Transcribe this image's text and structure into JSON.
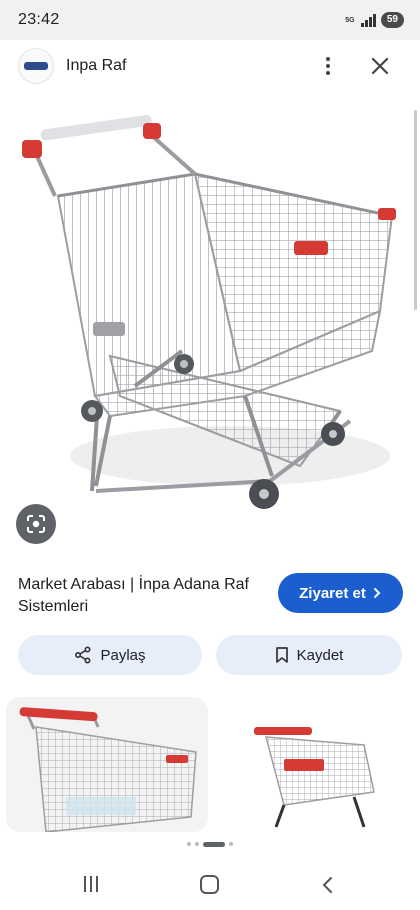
{
  "status_bar": {
    "time": "23:42",
    "network": "5G",
    "battery": "59"
  },
  "header": {
    "site_name": "Inpa Raf",
    "logo_icon": "inpa-logo-icon",
    "menu_icon": "more-vert-icon",
    "close_icon": "close-icon"
  },
  "image": {
    "description_icon": "shopping-cart-image",
    "lens_icon": "google-lens-icon"
  },
  "result": {
    "title": "Market Arabası | İnpa Adana Raf Sistemleri",
    "visit_label": "Ziyaret et",
    "visit_icon": "chevron-right-icon",
    "accent_color": "#1b5fce"
  },
  "actions": {
    "share_label": "Paylaş",
    "share_icon": "share-icon",
    "save_label": "Kaydet",
    "save_icon": "bookmark-icon"
  },
  "related": {
    "thumbnails": [
      "shopping-cart-thumbnail",
      "shopping-cart-thumbnail"
    ]
  },
  "pager": {
    "active_index": 2,
    "count": 4
  },
  "nav": {
    "recent_icon": "recent-apps-icon",
    "home_icon": "home-icon",
    "back_icon": "back-icon"
  }
}
